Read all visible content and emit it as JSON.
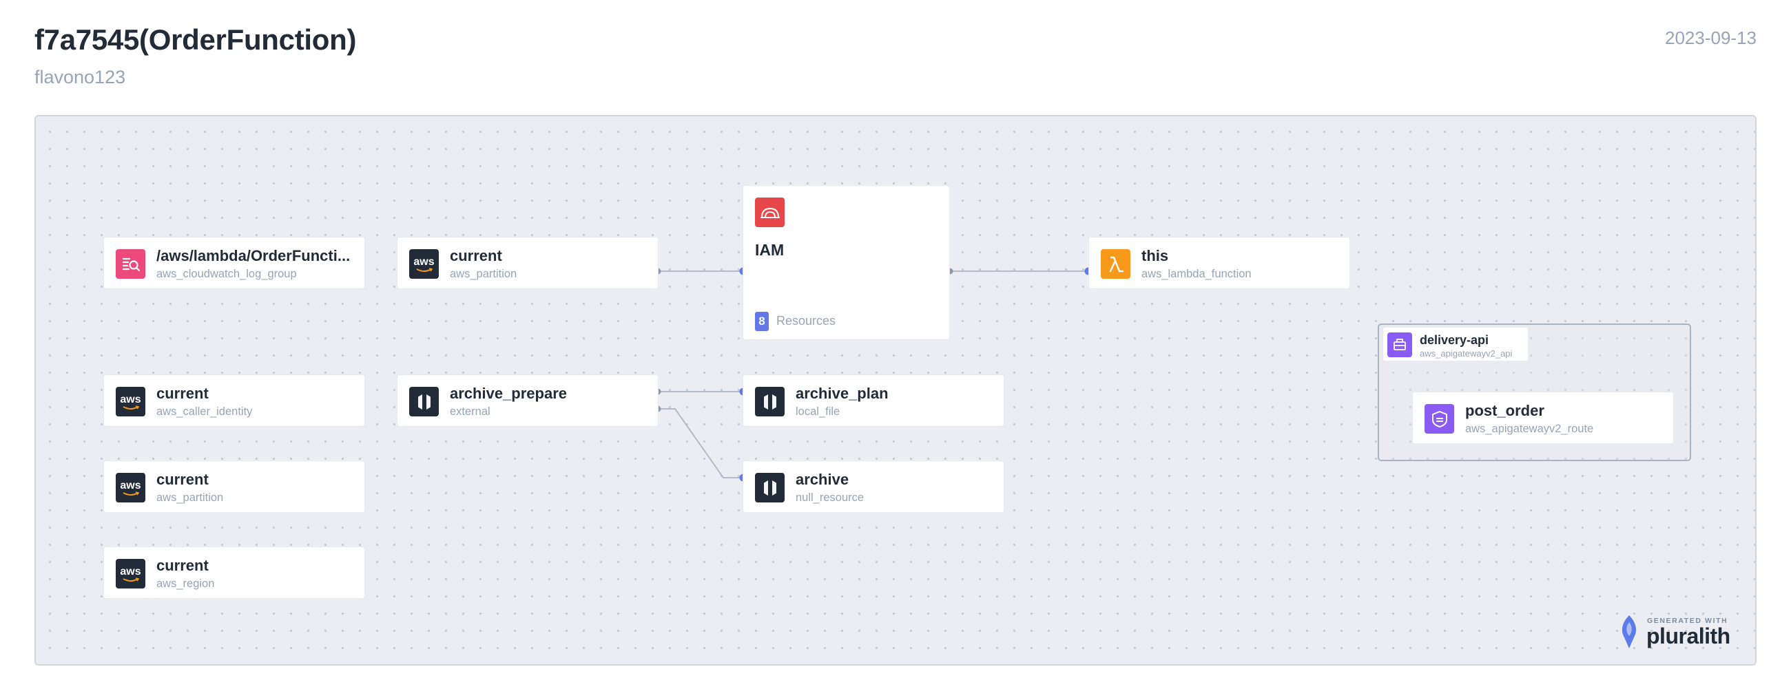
{
  "header": {
    "title": "f7a7545(OrderFunction)",
    "subtitle": "flavono123",
    "date": "2023-09-13"
  },
  "nodes": {
    "log_group": {
      "name": "/aws/lambda/OrderFuncti...",
      "type": "aws_cloudwatch_log_group",
      "icon": "cloudwatch-logs-icon"
    },
    "partition_1": {
      "name": "current",
      "type": "aws_partition",
      "icon": "aws-icon"
    },
    "caller_identity": {
      "name": "current",
      "type": "aws_caller_identity",
      "icon": "aws-icon"
    },
    "partition_2": {
      "name": "current",
      "type": "aws_partition",
      "icon": "aws-icon"
    },
    "region": {
      "name": "current",
      "type": "aws_region",
      "icon": "aws-icon"
    },
    "archive_prepare": {
      "name": "archive_prepare",
      "type": "external",
      "icon": "hashicorp-icon"
    },
    "archive_plan": {
      "name": "archive_plan",
      "type": "local_file",
      "icon": "hashicorp-icon"
    },
    "archive": {
      "name": "archive",
      "type": "null_resource",
      "icon": "hashicorp-icon"
    },
    "lambda": {
      "name": "this",
      "type": "aws_lambda_function",
      "icon": "lambda-icon"
    },
    "post_order": {
      "name": "post_order",
      "type": "aws_apigatewayv2_route",
      "icon": "api-route-icon"
    }
  },
  "iam_group": {
    "name": "IAM",
    "resource_count": "8",
    "resource_label": "Resources",
    "icon": "iam-icon"
  },
  "api_group": {
    "name": "delivery-api",
    "type": "aws_apigatewayv2_api",
    "icon": "api-gateway-icon"
  },
  "footer": {
    "generated_with": "GENERATED WITH",
    "brand": "pluralith"
  },
  "colors": {
    "edge": "#b3bac6",
    "port": "#5b7be8",
    "port_source": "#8f98a8",
    "accent_pink": "#ec4a7d",
    "accent_orange": "#f79a1b",
    "accent_purple": "#8a5cf5",
    "accent_red": "#e8474a"
  }
}
